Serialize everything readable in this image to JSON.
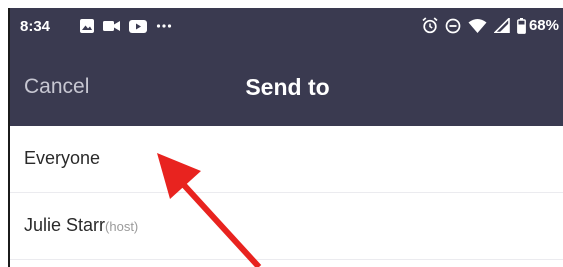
{
  "status_bar": {
    "time": "8:34",
    "battery_percent": "68%",
    "left_icons": [
      "image-icon",
      "video-camera-icon",
      "youtube-icon",
      "more-dots-icon"
    ],
    "right_icons": [
      "alarm-icon",
      "do-not-disturb-icon",
      "wifi-icon",
      "signal-icon",
      "battery-icon"
    ]
  },
  "nav": {
    "cancel_label": "Cancel",
    "title": "Send to"
  },
  "participants": [
    {
      "name": "Everyone",
      "suffix": ""
    },
    {
      "name": "Julie Starr",
      "suffix": "(host)"
    }
  ],
  "colors": {
    "header_bg": "#3a3a50",
    "annotation_arrow": "#e8231f"
  }
}
